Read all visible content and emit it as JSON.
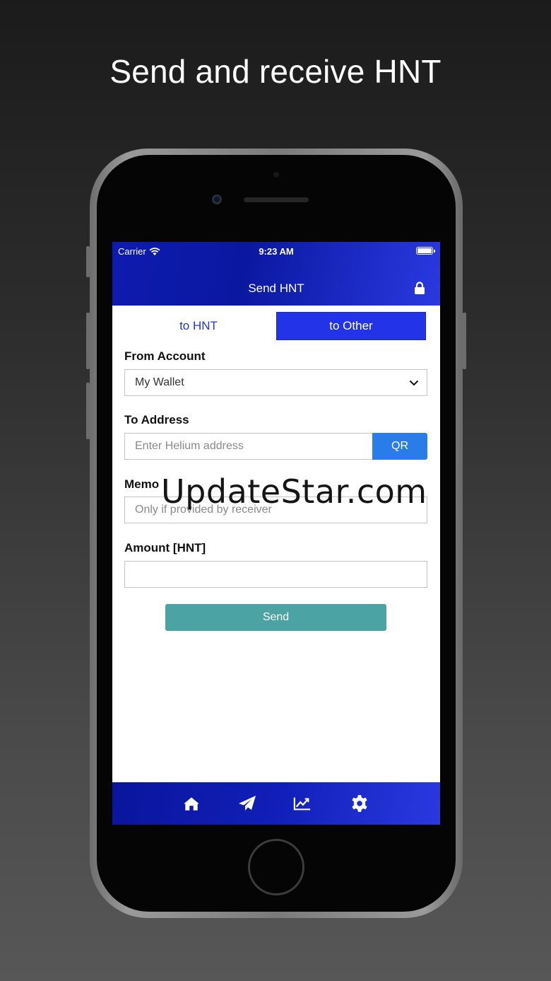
{
  "headline": "Send and receive HNT",
  "status_bar": {
    "carrier": "Carrier",
    "time": "9:23 AM"
  },
  "nav": {
    "title": "Send HNT"
  },
  "segments": {
    "hnt": "to HNT",
    "other": "to Other",
    "selected": "to Other"
  },
  "from_account": {
    "label": "From Account",
    "value": "My Wallet"
  },
  "to_address": {
    "label": "To Address",
    "placeholder": "Enter Helium address",
    "qr_label": "QR"
  },
  "memo": {
    "label": "Memo",
    "placeholder": "Only if provided by receiver"
  },
  "amount": {
    "label": "Amount [HNT]",
    "value": ""
  },
  "send_label": "Send",
  "watermark": "UpdateStar.com",
  "tabs": [
    "home-icon",
    "send-icon",
    "chart-icon",
    "gear-icon"
  ],
  "colors": {
    "accent": "#2334e8",
    "send_button": "#4ba3a3",
    "qr_button": "#2a7de8"
  }
}
